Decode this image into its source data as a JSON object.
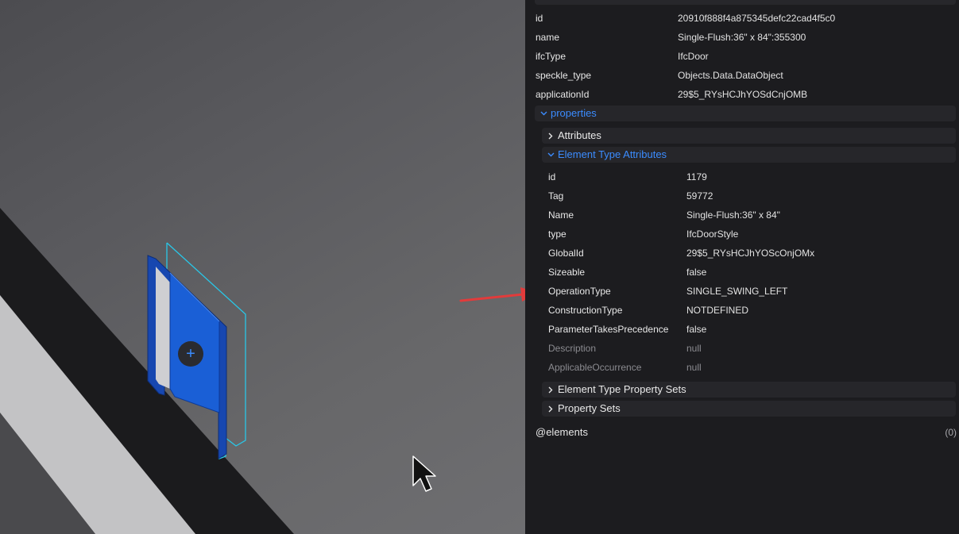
{
  "viewport": {
    "door_button_symbol": "+",
    "cursor_icon": "arrow-cursor-icon",
    "annotation_arrow_color": "#e23b3b",
    "selection_color": "#29c7e8",
    "door_color": "#1a5fd6"
  },
  "panel": {
    "top_props": [
      {
        "key": "id",
        "value": "20910f888f4a875345defc22cad4f5c0"
      },
      {
        "key": "name",
        "value": "Single-Flush:36\" x 84\":355300"
      },
      {
        "key": "ifcType",
        "value": "IfcDoor"
      },
      {
        "key": "speckle_type",
        "value": "Objects.Data.DataObject"
      },
      {
        "key": "applicationId",
        "value": "29$5_RYsHCJhYOSdCnjOMB"
      }
    ],
    "properties_label": "properties",
    "attributes_label": "Attributes",
    "element_type_attributes_label": "Element Type Attributes",
    "eta_props": [
      {
        "key": "id",
        "value": "1179"
      },
      {
        "key": "Tag",
        "value": "59772"
      },
      {
        "key": "Name",
        "value": "Single-Flush:36\" x 84\""
      },
      {
        "key": "type",
        "value": "IfcDoorStyle"
      },
      {
        "key": "GlobalId",
        "value": "29$5_RYsHCJhYOScOnjOMx"
      },
      {
        "key": "Sizeable",
        "value": "false"
      },
      {
        "key": "OperationType",
        "value": "SINGLE_SWING_LEFT"
      },
      {
        "key": "ConstructionType",
        "value": "NOTDEFINED"
      },
      {
        "key": "ParameterTakesPrecedence",
        "value": "false"
      },
      {
        "key": "Description",
        "value": "null"
      },
      {
        "key": "ApplicableOccurrence",
        "value": "null"
      }
    ],
    "element_type_property_sets_label": "Element Type Property Sets",
    "property_sets_label": "Property Sets",
    "elements_label": "@elements",
    "elements_count": "(0)",
    "accent_color": "#3b8cff"
  }
}
